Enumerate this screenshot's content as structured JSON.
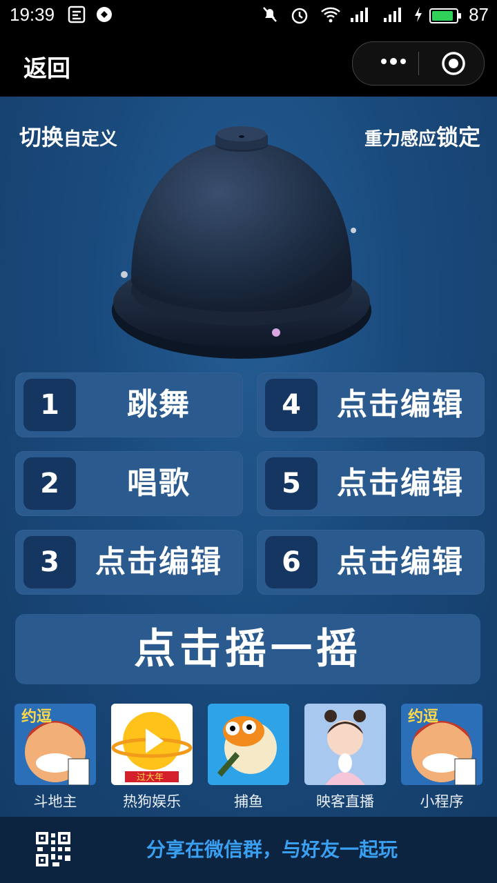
{
  "status_bar": {
    "time": "19:39",
    "battery": "87",
    "battery_color": "#30d158"
  },
  "nav": {
    "back_label": "返回",
    "more_icon": "more-dots-icon",
    "target_icon": "target-icon"
  },
  "header": {
    "switch_big": "切换",
    "switch_small": "自定义",
    "gravity_small": "重力感应",
    "gravity_big": "锁定"
  },
  "options": [
    {
      "num": "1",
      "label": "跳舞"
    },
    {
      "num": "2",
      "label": "唱歌"
    },
    {
      "num": "3",
      "label": "点击编辑"
    },
    {
      "num": "4",
      "label": "点击编辑"
    },
    {
      "num": "5",
      "label": "点击编辑"
    },
    {
      "num": "6",
      "label": "点击编辑"
    }
  ],
  "shake_button": "点击摇一摇",
  "apps": [
    {
      "name": "斗地主",
      "icon": "card-game-icon"
    },
    {
      "name": "热狗娱乐",
      "icon": "play-planet-icon"
    },
    {
      "name": "捕鱼",
      "icon": "pufferfish-icon"
    },
    {
      "name": "映客直播",
      "icon": "live-stream-icon"
    },
    {
      "name": "小程序",
      "icon": "card-game-icon"
    }
  ],
  "footer": {
    "share_text": "分享在微信群，与好友一起玩",
    "qr_icon": "qr-code-icon"
  },
  "colors": {
    "accent": "#3aa0f2",
    "tile": "#2a5a8e",
    "tile_num": "#143660",
    "background": "#1a4a7c"
  }
}
